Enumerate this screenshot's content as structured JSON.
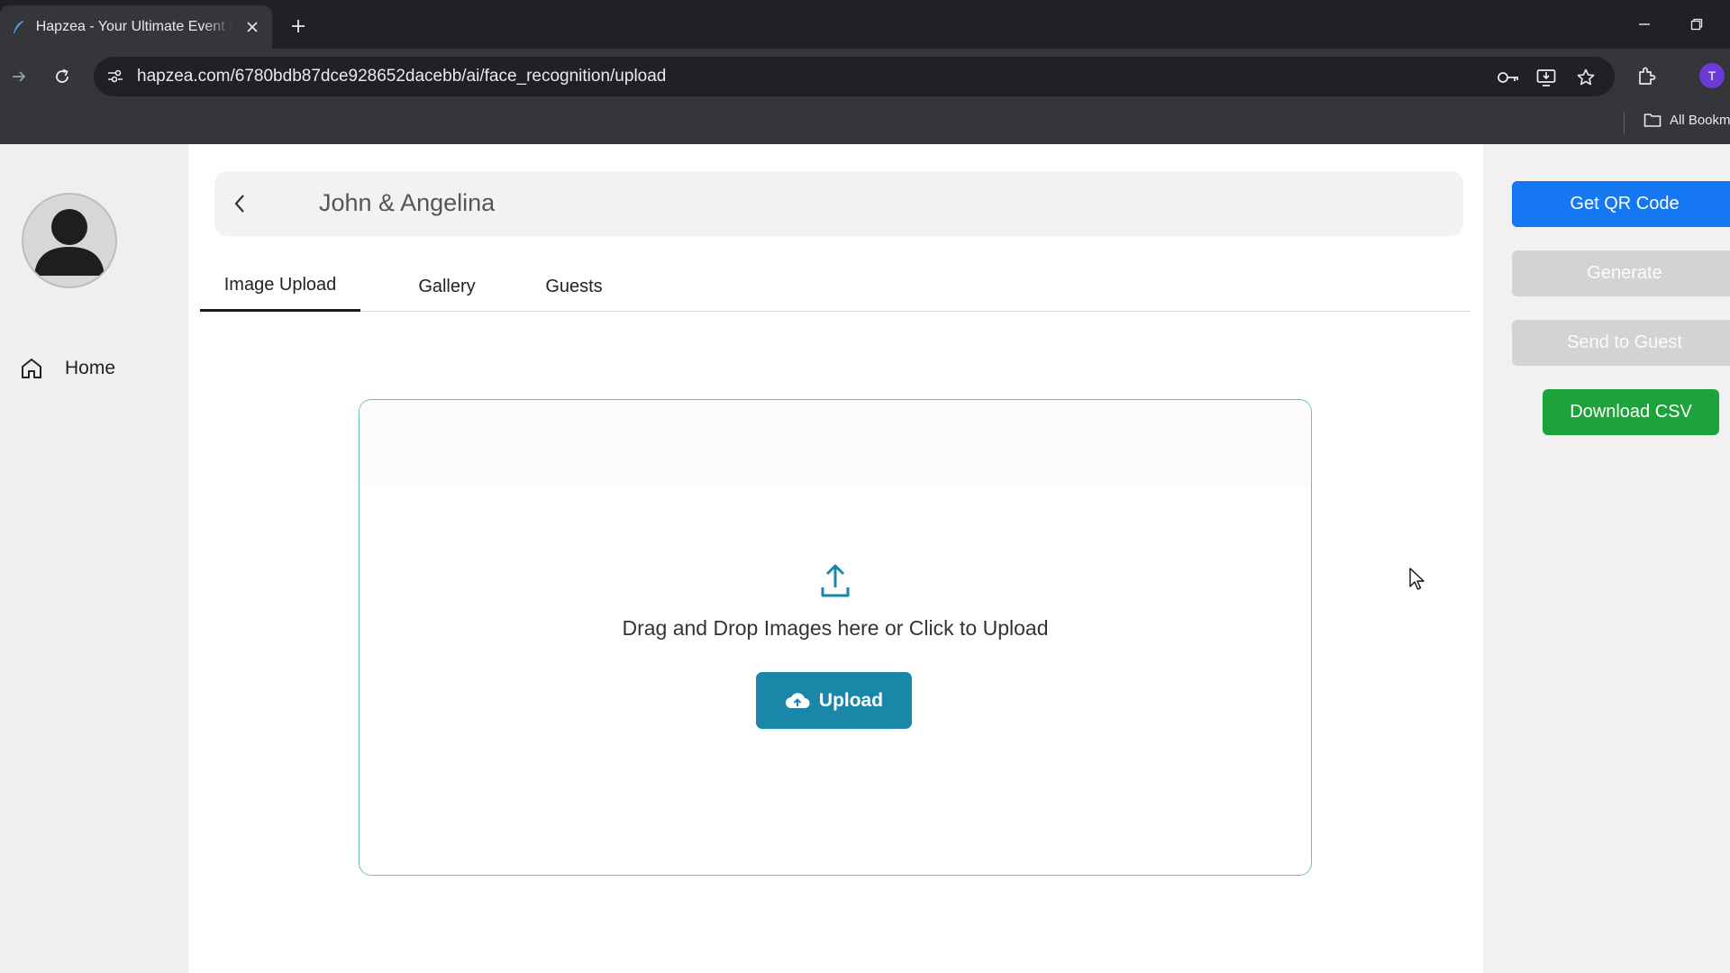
{
  "browser": {
    "tab_title": "Hapzea - Your Ultimate Event Planner",
    "url": "hapzea.com/6780bdb87dce928652dacebb/ai/face_recognition/upload",
    "bookmarks_label": "All Bookmarks",
    "profile_initial": "T"
  },
  "sidebar": {
    "items": [
      {
        "label": "Home",
        "icon": "home-icon"
      }
    ]
  },
  "header": {
    "title": "John & Angelina"
  },
  "tabs": [
    {
      "label": "Image Upload",
      "active": true
    },
    {
      "label": "Gallery",
      "active": false
    },
    {
      "label": "Guests",
      "active": false
    }
  ],
  "dropzone": {
    "instruction": "Drag and Drop Images here or Click to Upload",
    "upload_label": "Upload"
  },
  "actions": {
    "get_qr": "Get QR Code",
    "generate": "Generate",
    "send_to_guest": "Send to Guest",
    "download_csv": "Download CSV"
  },
  "colors": {
    "primary_blue": "#1677f2",
    "upload_teal": "#1a87a8",
    "dropzone_border": "#6fbfae",
    "success_green": "#1ea33c",
    "disabled_gray": "#d3d3d3"
  }
}
